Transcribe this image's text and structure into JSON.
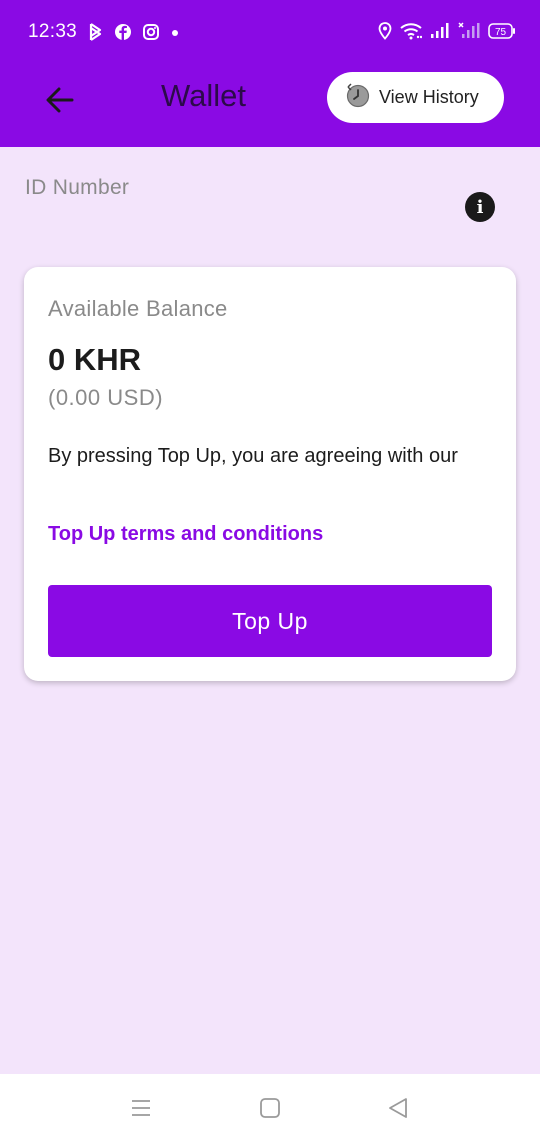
{
  "status_bar": {
    "time": "12:33",
    "battery": "75",
    "left_icons": [
      "bluetooth-icon",
      "facebook-icon",
      "instagram-icon",
      "dot-icon"
    ],
    "right_icons": [
      "location-icon",
      "wifi-icon",
      "signal-icon",
      "signal-no-sim-icon",
      "battery-icon"
    ]
  },
  "header": {
    "title": "Wallet",
    "back_icon": "arrow-left-icon",
    "history_button": {
      "label": "View History",
      "icon": "clock-history-icon"
    }
  },
  "id_section": {
    "label": "ID Number",
    "info_icon": "info-icon",
    "info_glyph": "i"
  },
  "balance_card": {
    "label": "Available Balance",
    "amount_khr": "0 KHR",
    "amount_usd": "(0.00 USD)",
    "agreement_text": "By pressing Top Up, you are agreeing with our",
    "terms_link": "Top Up terms and conditions",
    "topup_button": "Top Up"
  },
  "nav_bar": {
    "items": [
      "menu-icon",
      "home-icon",
      "back-icon"
    ]
  },
  "colors": {
    "primary": "#8a0ae4",
    "background": "#f3e4fb",
    "card": "#ffffff"
  }
}
